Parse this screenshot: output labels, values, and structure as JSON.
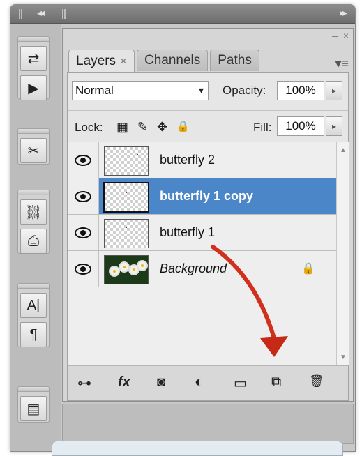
{
  "panel_tabs": [
    {
      "label": "Layers",
      "close": "×"
    },
    {
      "label": "Channels"
    },
    {
      "label": "Paths"
    }
  ],
  "controls": {
    "blend_mode": "Normal",
    "opacity_label": "Opacity:",
    "opacity_value": "100%",
    "lock_label": "Lock:",
    "fill_label": "Fill:",
    "fill_value": "100%"
  },
  "layers": [
    {
      "name": "butterfly 2",
      "selected": false
    },
    {
      "name": "butterfly 1 copy",
      "selected": true
    },
    {
      "name": "butterfly 1",
      "selected": false
    },
    {
      "name": "Background",
      "selected": false,
      "locked": true
    }
  ],
  "icons": {
    "collapse": "◂◂",
    "expand": "▸▸",
    "minimize": "–",
    "close": "×",
    "menu": "▾≡",
    "dropdown": "▾",
    "stepper": "▸",
    "lock_transparent": "▦",
    "lock_image": "✎",
    "lock_position": "✥",
    "lock_all": "🔒",
    "link": "⊶",
    "fx": "fx",
    "mask": "◙",
    "adjustment": "◐",
    "group": "▭",
    "new_layer": "⧉",
    "trash": "🗑",
    "scroll_up": "▲",
    "scroll_down": "▼",
    "tool_history": "⇄",
    "tool_actions": "▶",
    "tool_brushes": "✂",
    "tool_clone": "⛓",
    "tool_stamp": "⎙",
    "tool_character": "A|",
    "tool_paragraph": "¶",
    "tool_navigator": "▤"
  },
  "colors": {
    "selection": "#4a86c8",
    "arrow": "#d0301c"
  }
}
